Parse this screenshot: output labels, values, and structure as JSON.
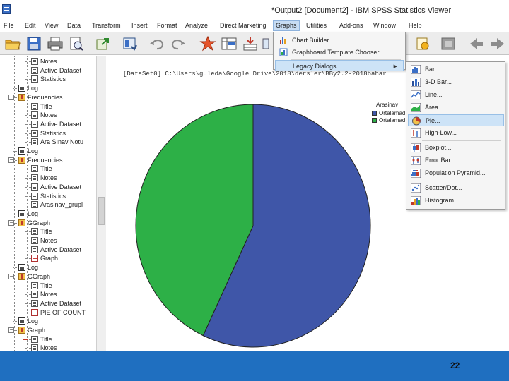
{
  "window": {
    "title": "*Output2 [Document2] - IBM SPSS Statistics Viewer"
  },
  "menubar": {
    "items": [
      {
        "label": "File"
      },
      {
        "label": "Edit"
      },
      {
        "label": "View"
      },
      {
        "label": "Data"
      },
      {
        "label": "Transform"
      },
      {
        "label": "Insert"
      },
      {
        "label": "Format"
      },
      {
        "label": "Analyze"
      },
      {
        "label": "Direct Marketing"
      },
      {
        "label": "Graphs",
        "active": true
      },
      {
        "label": "Utilities"
      },
      {
        "label": "Add-ons"
      },
      {
        "label": "Window"
      },
      {
        "label": "Help"
      }
    ]
  },
  "toolbar": {
    "icons": [
      "open-folder-icon",
      "save-icon",
      "print-icon",
      "print-preview-icon",
      "export-icon",
      "recall-dialog-icon",
      "undo-icon",
      "redo-icon",
      "go-to-data-icon",
      "go-to-case-icon",
      "variables-icon",
      "insert-icon",
      "run-script-icon",
      "designate-window-icon",
      "back-icon",
      "forward-icon"
    ]
  },
  "graphs_menu": {
    "items": [
      {
        "label": "Chart Builder...",
        "icon": "chart-builder-icon"
      },
      {
        "label": "Graphboard Template Chooser...",
        "icon": "graphboard-icon"
      },
      {
        "label": "Legacy Dialogs",
        "has_submenu": true,
        "highlighted": true
      }
    ]
  },
  "legacy_menu": {
    "items": [
      {
        "label": "Bar...",
        "icon": "bar-chart-icon"
      },
      {
        "label": "3-D Bar...",
        "icon": "3d-bar-chart-icon"
      },
      {
        "label": "Line...",
        "icon": "line-chart-icon"
      },
      {
        "label": "Area...",
        "icon": "area-chart-icon"
      },
      {
        "label": "Pie...",
        "icon": "pie-chart-icon",
        "highlighted": true
      },
      {
        "label": "High-Low...",
        "icon": "high-low-chart-icon"
      },
      {
        "label": "Boxplot...",
        "icon": "boxplot-icon"
      },
      {
        "label": "Error Bar...",
        "icon": "error-bar-icon"
      },
      {
        "label": "Population Pyramid...",
        "icon": "population-pyramid-icon"
      },
      {
        "label": "Scatter/Dot...",
        "icon": "scatter-dot-icon"
      },
      {
        "label": "Histogram...",
        "icon": "histogram-icon"
      }
    ]
  },
  "outline": {
    "rows": [
      {
        "label": "Notes",
        "icon": "page",
        "level": 3
      },
      {
        "label": "Active Dataset",
        "icon": "page",
        "level": 3
      },
      {
        "label": "Statistics",
        "icon": "page",
        "level": 3
      },
      {
        "label": "Log",
        "icon": "log",
        "level": 1
      },
      {
        "label": "Frequencies",
        "icon": "book",
        "level": 1,
        "expander": "−"
      },
      {
        "label": "Title",
        "icon": "page",
        "level": 2
      },
      {
        "label": "Notes",
        "icon": "page",
        "level": 2
      },
      {
        "label": "Active Dataset",
        "icon": "page",
        "level": 2
      },
      {
        "label": "Statistics",
        "icon": "page",
        "level": 2
      },
      {
        "label": "Ara Sınav Notu",
        "icon": "page",
        "level": 2
      },
      {
        "label": "Log",
        "icon": "log",
        "level": 1
      },
      {
        "label": "Frequencies",
        "icon": "book",
        "level": 1,
        "expander": "−"
      },
      {
        "label": "Title",
        "icon": "page",
        "level": 2
      },
      {
        "label": "Notes",
        "icon": "page",
        "level": 2
      },
      {
        "label": "Active Dataset",
        "icon": "page",
        "level": 2
      },
      {
        "label": "Statistics",
        "icon": "page",
        "level": 2
      },
      {
        "label": "Arasinav_grupl",
        "icon": "page",
        "level": 2
      },
      {
        "label": "Log",
        "icon": "log",
        "level": 1
      },
      {
        "label": "GGraph",
        "icon": "book",
        "level": 1,
        "expander": "−"
      },
      {
        "label": "Title",
        "icon": "page",
        "level": 2
      },
      {
        "label": "Notes",
        "icon": "page",
        "level": 2
      },
      {
        "label": "Active Dataset",
        "icon": "page",
        "level": 2
      },
      {
        "label": "Graph",
        "icon": "chart",
        "level": 2
      },
      {
        "label": "Log",
        "icon": "log",
        "level": 1
      },
      {
        "label": "GGraph",
        "icon": "book",
        "level": 1,
        "expander": "−"
      },
      {
        "label": "Title",
        "icon": "page",
        "level": 2
      },
      {
        "label": "Notes",
        "icon": "page",
        "level": 2
      },
      {
        "label": "Active Dataset",
        "icon": "page",
        "level": 2
      },
      {
        "label": "PIE OF COUNT",
        "icon": "chart",
        "level": 2
      },
      {
        "label": "Log",
        "icon": "log",
        "level": 1
      },
      {
        "label": "Graph",
        "icon": "book",
        "level": 1,
        "expander": "−"
      },
      {
        "label": "Title",
        "icon": "page",
        "level": 2,
        "arrow": true
      },
      {
        "label": "Notes",
        "icon": "page",
        "level": 2
      }
    ]
  },
  "content": {
    "dataset_line": "[DataSet0] C:\\Users\\guleda\\Google Drive\\2018\\dersler\\BBy2.2-2018bahar"
  },
  "chart_data": {
    "type": "pie",
    "legend_title": "Arasinav",
    "series": [
      {
        "name": "Ortalamadı",
        "value": 57,
        "color": "#3f56a8"
      },
      {
        "name": "Ortalamadı",
        "value": 43,
        "color": "#2db047"
      }
    ],
    "start_angle_deg": 0,
    "direction": "clockwise"
  },
  "footer": {
    "page_number": "22",
    "bar_color": "#1f6fc0"
  }
}
